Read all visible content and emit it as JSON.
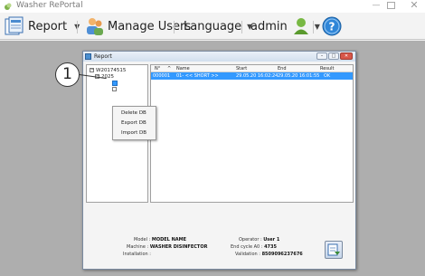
{
  "window": {
    "title": "Washer RePortal"
  },
  "toolbar": {
    "report_label": "Report",
    "manage_users_label": "Manage Users",
    "language_label": "Language",
    "user_label": "admin"
  },
  "dialog": {
    "title": "Report",
    "tree": {
      "root": "W20174515",
      "year": "2025"
    },
    "context_menu": [
      "Delete DB",
      "Export DB",
      "Import DB"
    ],
    "table": {
      "headers": [
        "N°",
        "Name",
        "Start",
        "End",
        "Result"
      ],
      "rows": [
        {
          "n": "000001",
          "name": "01- << SHORT >>",
          "start": "29.05.20 16:02:24",
          "end": "29.05.20 16:01:55",
          "result": "OK"
        }
      ]
    },
    "info": {
      "model_label": "Model :",
      "model_value": "MODEL NAME",
      "machine_label": "Machine :",
      "machine_value": "WASHER DISINFECTOR",
      "installation_label": "Installation :",
      "installation_value": "",
      "operator_label": "Operator :",
      "operator_value": "User 1",
      "end_cycle_label": "End cycle A0 :",
      "end_cycle_value": "4735",
      "validation_label": "Validation :",
      "validation_value": "8509096237676"
    }
  },
  "callout": {
    "number": "1"
  },
  "colors": {
    "selection": "#3399ff",
    "workspace": "#aeaeae"
  }
}
